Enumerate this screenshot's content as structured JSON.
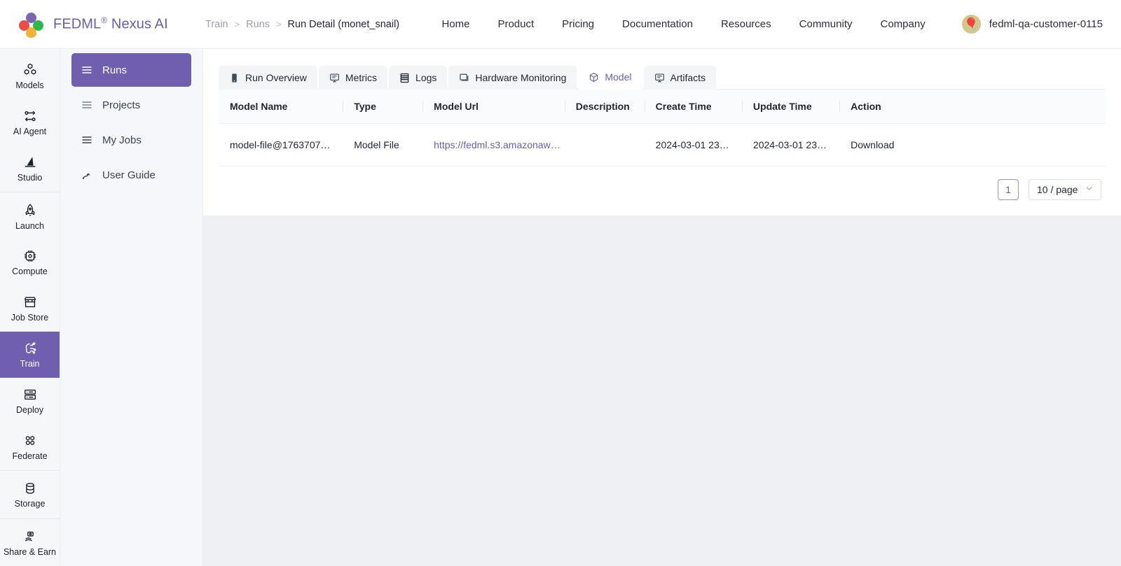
{
  "brand": {
    "name": "FEDML",
    "registered": "®",
    "product": "Nexus AI"
  },
  "breadcrumb": {
    "items": [
      "Train",
      "Runs",
      "Run Detail (monet_snail)"
    ],
    "separator": ">"
  },
  "mainnav": {
    "items": [
      "Home",
      "Product",
      "Pricing",
      "Documentation",
      "Resources",
      "Community",
      "Company"
    ]
  },
  "user": {
    "name": "fedml-qa-customer-0115",
    "avatar_icon": "hot-air-balloon-icon",
    "avatar_bg": "#cfc98e"
  },
  "rail": {
    "items": [
      {
        "label": "Models",
        "icon": "models-cubes-icon",
        "active": false
      },
      {
        "label": "AI Agent",
        "icon": "ai-agent-icon",
        "active": false
      },
      {
        "label": "Studio",
        "icon": "studio-wizard-hat-icon",
        "active": false
      },
      {
        "label": "Launch",
        "icon": "rocket-icon",
        "active": false
      },
      {
        "label": "Compute",
        "icon": "cpu-chip-icon",
        "active": false
      },
      {
        "label": "Job Store",
        "icon": "storefront-icon",
        "active": false
      },
      {
        "label": "Train",
        "icon": "brain-circuit-icon",
        "active": true
      },
      {
        "label": "Deploy",
        "icon": "server-rack-icon",
        "active": false
      },
      {
        "label": "Federate",
        "icon": "federate-nodes-icon",
        "active": false
      },
      {
        "label": "Storage",
        "icon": "database-icon",
        "active": false
      },
      {
        "label": "Share & Earn",
        "icon": "share-earn-icon",
        "active": false
      }
    ],
    "separator_after": [
      2,
      8,
      9
    ]
  },
  "subnav": {
    "items": [
      {
        "label": "Runs",
        "icon": "list-lines-icon",
        "active": true
      },
      {
        "label": "Projects",
        "icon": "list-lines-icon",
        "active": false
      },
      {
        "label": "My Jobs",
        "icon": "list-lines-icon",
        "active": false
      },
      {
        "label": "User Guide",
        "icon": "guide-path-icon",
        "active": false
      }
    ]
  },
  "tabs": {
    "items": [
      {
        "label": "Run Overview",
        "icon": "device-icon",
        "active": false
      },
      {
        "label": "Metrics",
        "icon": "monitor-icon",
        "active": false
      },
      {
        "label": "Logs",
        "icon": "logs-icon",
        "active": false
      },
      {
        "label": "Hardware Monitoring",
        "icon": "display-icon",
        "active": false
      },
      {
        "label": "Model",
        "icon": "cube-icon",
        "active": true
      },
      {
        "label": "Artifacts",
        "icon": "monitor-icon",
        "active": false
      }
    ]
  },
  "table": {
    "columns": [
      "Model Name",
      "Type",
      "Model Url",
      "Description",
      "Create Time",
      "Update Time",
      "Action"
    ],
    "rows": [
      {
        "model_name": "model-file@1763707…",
        "type": "Model File",
        "model_url": "https://fedml.s3.amazonaw…",
        "description": "",
        "create_time": "2024-03-01 23…",
        "update_time": "2024-03-01 23…",
        "action": "Download"
      }
    ]
  },
  "pagination": {
    "current_page": "1",
    "page_size": "10 / page",
    "chevron": "⌄"
  },
  "colors": {
    "accent": "#6f5fae",
    "link": "#6a5eab",
    "page_bg": "#eff0f4",
    "rail_bg": "#f6f7f9"
  }
}
